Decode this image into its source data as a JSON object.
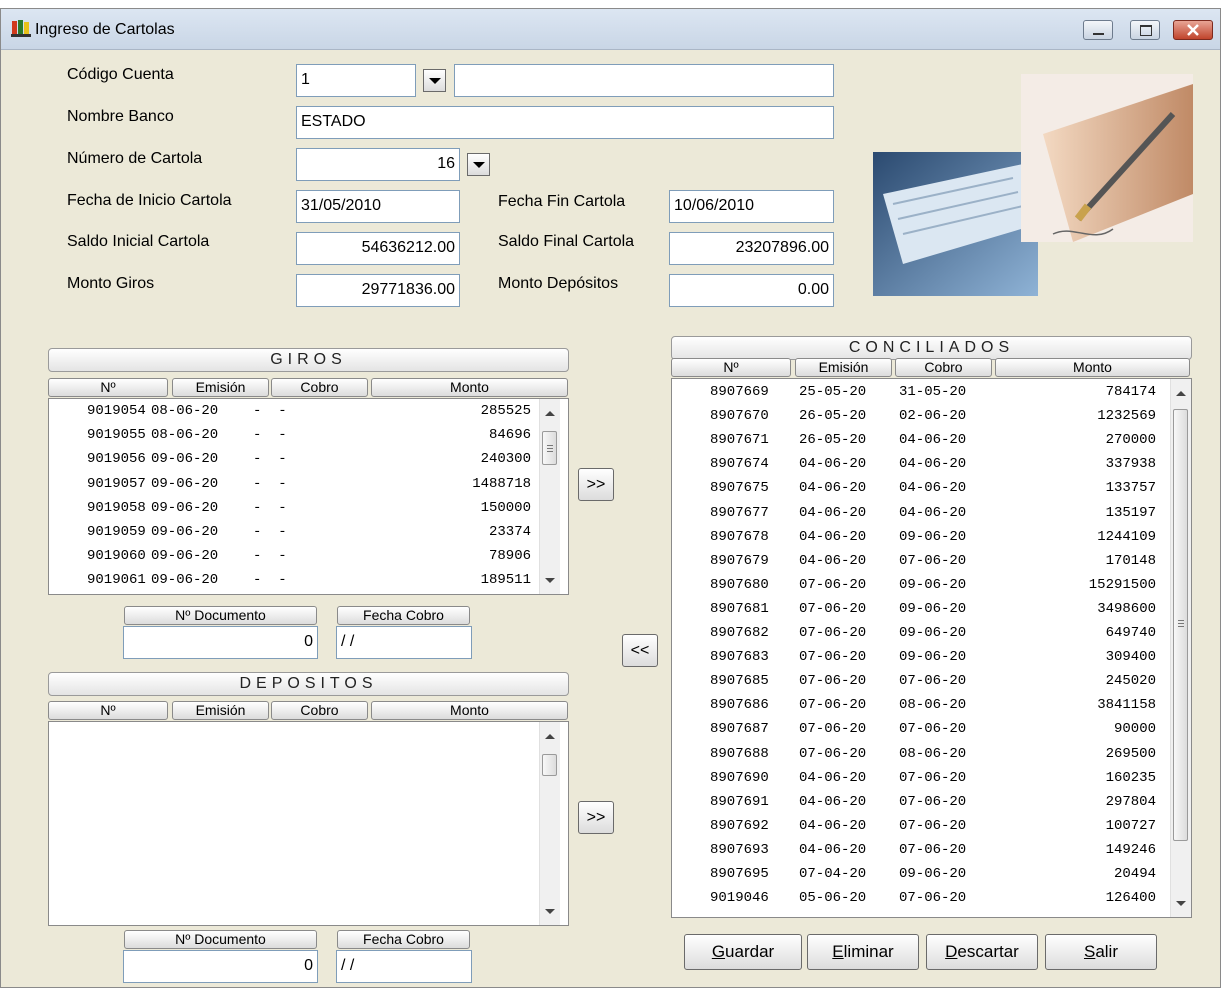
{
  "window": {
    "title": "Ingreso de Cartolas"
  },
  "form": {
    "codigo_cuenta_label": "Código Cuenta",
    "codigo_cuenta_value": "1",
    "codigo_cuenta_desc": "",
    "nombre_banco_label": "Nombre Banco",
    "nombre_banco_value": "ESTADO",
    "numero_cartola_label": "Número de Cartola",
    "numero_cartola_value": "16",
    "fecha_inicio_label": "Fecha de Inicio Cartola",
    "fecha_inicio_value": "31/05/2010",
    "fecha_fin_label": "Fecha Fin Cartola",
    "fecha_fin_value": "10/06/2010",
    "saldo_inicial_label": "Saldo Inicial Cartola",
    "saldo_inicial_value": "54636212.00",
    "saldo_final_label": "Saldo Final Cartola",
    "saldo_final_value": "23207896.00",
    "monto_giros_label": "Monto Giros",
    "monto_giros_value": "29771836.00",
    "monto_depositos_label": "Monto Depósitos",
    "monto_depositos_value": "0.00"
  },
  "columns": {
    "num": "Nº",
    "emision": "Emisión",
    "cobro": "Cobro",
    "monto": "Monto"
  },
  "giros": {
    "title": "GIROS",
    "rows": [
      [
        "9019054",
        "08-06-20",
        "-  -",
        "285525"
      ],
      [
        "9019055",
        "08-06-20",
        "-  -",
        "84696"
      ],
      [
        "9019056",
        "09-06-20",
        "-  -",
        "240300"
      ],
      [
        "9019057",
        "09-06-20",
        "-  -",
        "1488718"
      ],
      [
        "9019058",
        "09-06-20",
        "-  -",
        "150000"
      ],
      [
        "9019059",
        "09-06-20",
        "-  -",
        "23374"
      ],
      [
        "9019060",
        "09-06-20",
        "-  -",
        "78906"
      ],
      [
        "9019061",
        "09-06-20",
        "-  -",
        "189511"
      ]
    ],
    "doc_label": "Nº Documento",
    "doc_value": "0",
    "fecha_label": "Fecha Cobro",
    "fecha_value": "/ /"
  },
  "depositos": {
    "title": "DEPOSITOS",
    "doc_label": "Nº Documento",
    "doc_value": "0",
    "fecha_label": "Fecha Cobro",
    "fecha_value": "/ /"
  },
  "conciliados": {
    "title": "CONCILIADOS",
    "rows": [
      [
        "8907669",
        "25-05-20",
        "31-05-20",
        "784174"
      ],
      [
        "8907670",
        "26-05-20",
        "02-06-20",
        "1232569"
      ],
      [
        "8907671",
        "26-05-20",
        "04-06-20",
        "270000"
      ],
      [
        "8907674",
        "04-06-20",
        "04-06-20",
        "337938"
      ],
      [
        "8907675",
        "04-06-20",
        "04-06-20",
        "133757"
      ],
      [
        "8907677",
        "04-06-20",
        "04-06-20",
        "135197"
      ],
      [
        "8907678",
        "04-06-20",
        "09-06-20",
        "1244109"
      ],
      [
        "8907679",
        "04-06-20",
        "07-06-20",
        "170148"
      ],
      [
        "8907680",
        "07-06-20",
        "09-06-20",
        "15291500"
      ],
      [
        "8907681",
        "07-06-20",
        "09-06-20",
        "3498600"
      ],
      [
        "8907682",
        "07-06-20",
        "09-06-20",
        "649740"
      ],
      [
        "8907683",
        "07-06-20",
        "09-06-20",
        "309400"
      ],
      [
        "8907685",
        "07-06-20",
        "07-06-20",
        "245020"
      ],
      [
        "8907686",
        "07-06-20",
        "08-06-20",
        "3841158"
      ],
      [
        "8907687",
        "07-06-20",
        "07-06-20",
        "90000"
      ],
      [
        "8907688",
        "07-06-20",
        "08-06-20",
        "269500"
      ],
      [
        "8907690",
        "04-06-20",
        "07-06-20",
        "160235"
      ],
      [
        "8907691",
        "04-06-20",
        "07-06-20",
        "297804"
      ],
      [
        "8907692",
        "04-06-20",
        "07-06-20",
        "100727"
      ],
      [
        "8907693",
        "04-06-20",
        "07-06-20",
        "149246"
      ],
      [
        "8907695",
        "07-04-20",
        "09-06-20",
        "20494"
      ],
      [
        "9019046",
        "05-06-20",
        "07-06-20",
        "126400"
      ]
    ]
  },
  "buttons": {
    "move_right": ">>",
    "move_left": "<<",
    "guardar_u": "G",
    "guardar_rest": "uardar",
    "eliminar_u": "E",
    "eliminar_rest": "liminar",
    "descartar_u": "D",
    "descartar_rest": "escartar",
    "salir_u": "S",
    "salir_rest": "alir"
  }
}
